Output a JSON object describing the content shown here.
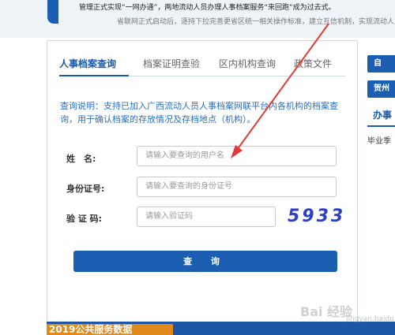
{
  "notice": {
    "line1": "管理正式实现“一网办通”，两地流动人员办理人事档案服务“来回跑”成为过去式。",
    "line2": "省联网正式启动后，逐持下拉完善更省区统一相关操作标准，建立互信机制，实现流动人员人事"
  },
  "tabs": [
    {
      "label": "人事档案查询",
      "active": true
    },
    {
      "label": "档案证明查验",
      "active": false
    },
    {
      "label": "区内机构查询",
      "active": false
    },
    {
      "label": "政策文件",
      "active": false
    }
  ],
  "description": "查询说明：支持已加入广西流动人员人事档案网联平台内各机构的档案查询，用于确认档案的存放情况及存档地点（机构）。",
  "form": {
    "name_label": "姓　名:",
    "name_placeholder": "请输入要查询的用户名",
    "id_label": "身份证号:",
    "id_placeholder": "请输入要查询的身份证号",
    "code_label": "验 证 码:",
    "code_placeholder": "请输入验证码",
    "captcha": "5933",
    "submit": "查 询"
  },
  "right": {
    "btn1": "自",
    "btn2": "贺州",
    "heading": "办事",
    "line": "毕业季"
  },
  "bottom": {
    "text": "2019公共服务数据"
  },
  "watermark": {
    "main": "Bai 经验",
    "sub": "jingyan.baidu.com"
  },
  "colors": {
    "accent": "#1c5fb2",
    "link": "#2a6fc2",
    "captcha": "#2b3fc8",
    "arrow": "#e53935"
  }
}
